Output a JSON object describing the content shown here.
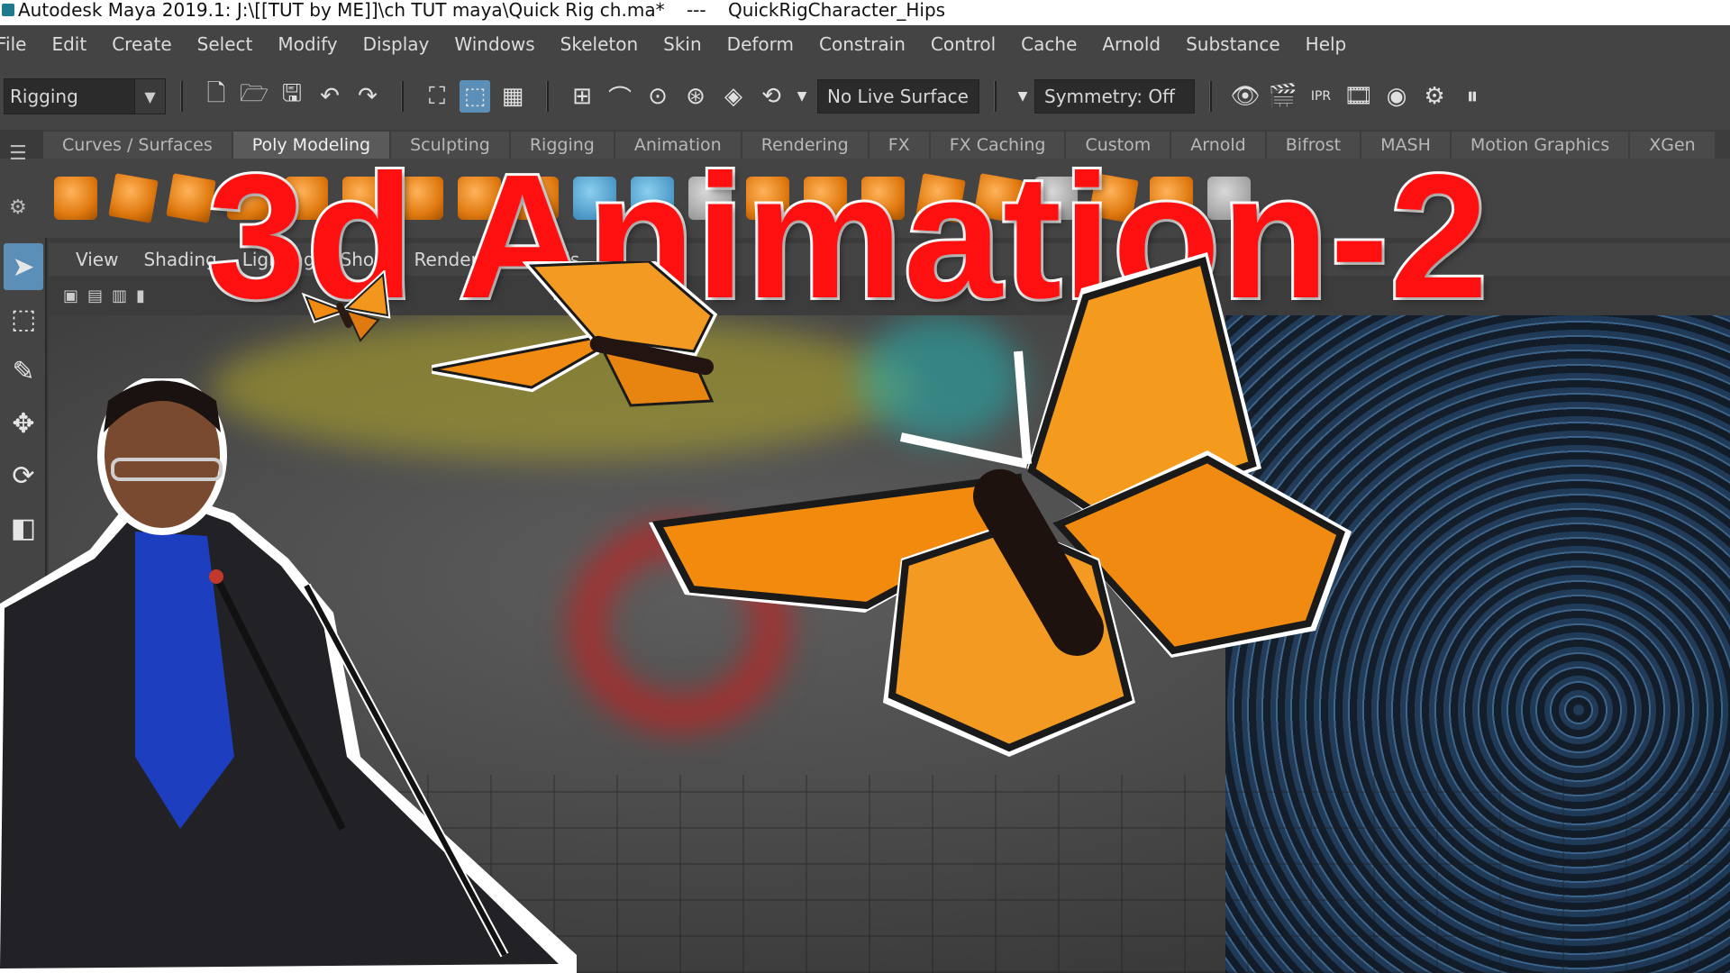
{
  "window": {
    "title": "Autodesk Maya 2019.1: J:\\[[TUT by ME]]\\ch TUT maya\\Quick Rig ch.ma*",
    "separator": "---",
    "selection": "QuickRigCharacter_Hips"
  },
  "menubar": {
    "items": [
      "File",
      "Edit",
      "Create",
      "Select",
      "Modify",
      "Display",
      "Windows",
      "Skeleton",
      "Skin",
      "Deform",
      "Constrain",
      "Control",
      "Cache",
      "Arnold",
      "Substance",
      "Help"
    ]
  },
  "statusline": {
    "mode": "Rigging",
    "live_surface": "No Live Surface",
    "symmetry": "Symmetry: Off"
  },
  "shelf": {
    "tabs": [
      "Curves / Surfaces",
      "Poly Modeling",
      "Sculpting",
      "Rigging",
      "Animation",
      "Rendering",
      "FX",
      "FX Caching",
      "Custom",
      "Arnold",
      "Bifrost",
      "MASH",
      "Motion Graphics",
      "XGen"
    ],
    "active_tab": "Poly Modeling"
  },
  "panel": {
    "menu": [
      "View",
      "Shading",
      "Lighting",
      "Show",
      "Renderer",
      "Panels"
    ]
  },
  "overlay": {
    "title": "3d Animation-2",
    "title_color": "#ff1010"
  },
  "colors": {
    "maya_bg": "#444444",
    "active_blue": "#5b8fb8",
    "butterfly_orange": "#f08a10"
  }
}
